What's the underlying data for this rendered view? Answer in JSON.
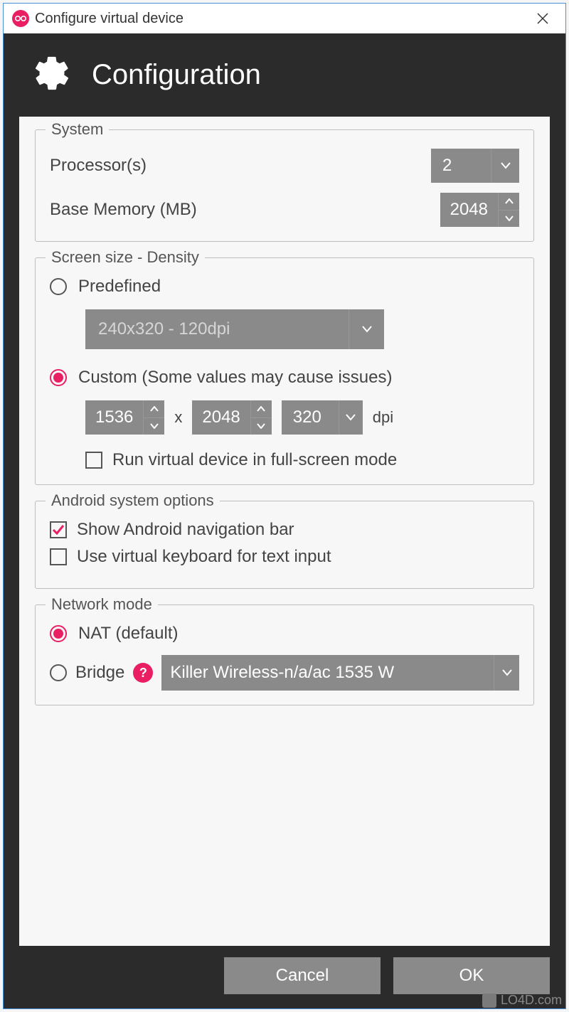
{
  "window": {
    "title": "Configure virtual device"
  },
  "header": {
    "title": "Configuration"
  },
  "system": {
    "legend": "System",
    "processors_label": "Processor(s)",
    "processors_value": "2",
    "memory_label": "Base Memory (MB)",
    "memory_value": "2048"
  },
  "screen": {
    "legend": "Screen size - Density",
    "predefined_label": "Predefined",
    "predefined_value": "240x320 - 120dpi",
    "custom_label": "Custom (Some values may cause issues)",
    "width": "1536",
    "times": "x",
    "height": "2048",
    "dpi": "320",
    "dpi_unit": "dpi",
    "fullscreen_label": "Run virtual device in full-screen mode",
    "selected": "custom",
    "fullscreen_checked": false
  },
  "android": {
    "legend": "Android system options",
    "navbar_label": "Show Android navigation bar",
    "navbar_checked": true,
    "vkbd_label": "Use virtual keyboard for text input",
    "vkbd_checked": false
  },
  "network": {
    "legend": "Network mode",
    "nat_label": "NAT (default)",
    "bridge_label": "Bridge",
    "bridge_adapter": "Killer Wireless-n/a/ac 1535 W",
    "selected": "nat",
    "help": "?"
  },
  "footer": {
    "cancel": "Cancel",
    "ok": "OK"
  },
  "watermark": "LO4D.com"
}
